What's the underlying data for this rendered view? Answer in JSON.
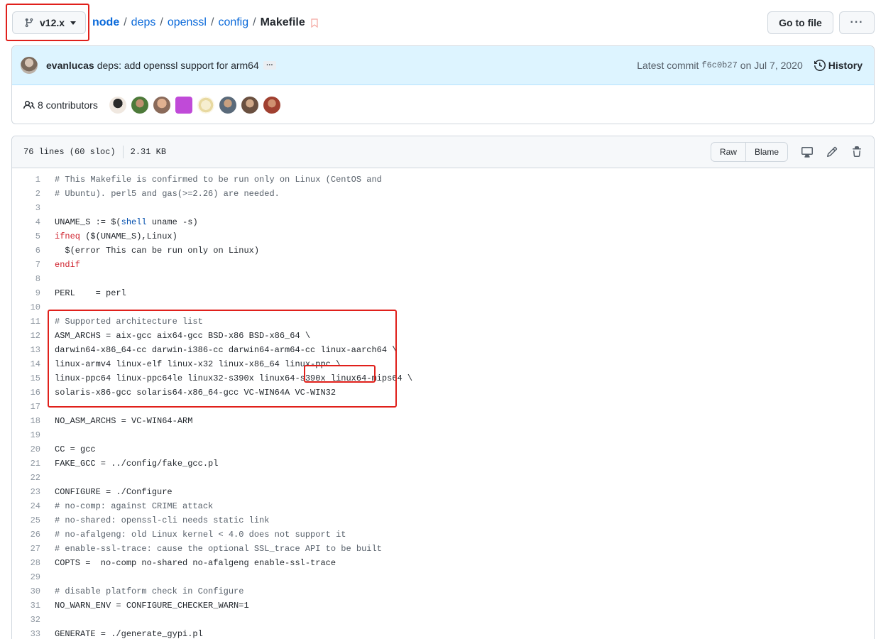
{
  "branch": {
    "name": "v12.x"
  },
  "breadcrumb": {
    "items": [
      "node",
      "deps",
      "openssl",
      "config"
    ],
    "current": "Makefile"
  },
  "header_actions": {
    "goto_file": "Go to file",
    "more": "···"
  },
  "commit": {
    "author": "evanlucas",
    "message": "deps: add openssl support for arm64",
    "ellipsis": "…",
    "latest_label": "Latest commit",
    "sha": "f6c0b27",
    "date": "on Jul 7, 2020",
    "history": "History"
  },
  "contributors": {
    "label": "8 contributors",
    "count": 8
  },
  "file": {
    "info_lines": "76 lines (60 sloc)",
    "info_size": "2.31 KB",
    "raw": "Raw",
    "blame": "Blame"
  },
  "code_lines": [
    {
      "n": "1",
      "parts": [
        {
          "t": "# This Makefile is confirmed to be run only on Linux (CentOS and",
          "k": "c"
        }
      ]
    },
    {
      "n": "2",
      "parts": [
        {
          "t": "# Ubuntu). perl5 and gas(>=2.26) are needed.",
          "k": "c"
        }
      ]
    },
    {
      "n": "3",
      "parts": [
        {
          "t": "",
          "k": ""
        }
      ]
    },
    {
      "n": "4",
      "parts": [
        {
          "t": "UNAME_S := $(",
          "k": ""
        },
        {
          "t": "shell",
          "k": "f"
        },
        {
          "t": " uname -s)",
          "k": ""
        }
      ]
    },
    {
      "n": "5",
      "parts": [
        {
          "t": "ifneq",
          "k": "k"
        },
        {
          "t": " ($(UNAME_S),Linux)",
          "k": ""
        }
      ]
    },
    {
      "n": "6",
      "parts": [
        {
          "t": "  $(error This can be run only on Linux)",
          "k": ""
        }
      ]
    },
    {
      "n": "7",
      "parts": [
        {
          "t": "endif",
          "k": "k"
        }
      ]
    },
    {
      "n": "8",
      "parts": [
        {
          "t": "",
          "k": ""
        }
      ]
    },
    {
      "n": "9",
      "parts": [
        {
          "t": "PERL    = perl",
          "k": ""
        }
      ]
    },
    {
      "n": "10",
      "parts": [
        {
          "t": "",
          "k": ""
        }
      ]
    },
    {
      "n": "11",
      "parts": [
        {
          "t": "# Supported architecture list",
          "k": "c"
        }
      ]
    },
    {
      "n": "12",
      "parts": [
        {
          "t": "ASM_ARCHS = aix-gcc aix64-gcc BSD-x86 BSD-x86_64 \\",
          "k": ""
        }
      ]
    },
    {
      "n": "13",
      "parts": [
        {
          "t": "darwin64-x86_64-cc darwin-i386-cc darwin64-arm64-cc linux-aarch64 \\",
          "k": ""
        }
      ]
    },
    {
      "n": "14",
      "parts": [
        {
          "t": "linux-armv4 linux-elf linux-x32 linux-x86_64 linux-ppc \\",
          "k": ""
        }
      ]
    },
    {
      "n": "15",
      "parts": [
        {
          "t": "linux-ppc64 linux-ppc64le linux32-s390x linux64-s390x linux64-mips64 \\",
          "k": ""
        }
      ]
    },
    {
      "n": "16",
      "parts": [
        {
          "t": "solaris-x86-gcc solaris64-x86_64-gcc VC-WIN64A VC-WIN32",
          "k": ""
        }
      ]
    },
    {
      "n": "17",
      "parts": [
        {
          "t": "",
          "k": ""
        }
      ]
    },
    {
      "n": "18",
      "parts": [
        {
          "t": "NO_ASM_ARCHS = VC-WIN64-ARM",
          "k": ""
        }
      ]
    },
    {
      "n": "19",
      "parts": [
        {
          "t": "",
          "k": ""
        }
      ]
    },
    {
      "n": "20",
      "parts": [
        {
          "t": "CC = gcc",
          "k": ""
        }
      ]
    },
    {
      "n": "21",
      "parts": [
        {
          "t": "FAKE_GCC = ../config/fake_gcc.pl",
          "k": ""
        }
      ]
    },
    {
      "n": "22",
      "parts": [
        {
          "t": "",
          "k": ""
        }
      ]
    },
    {
      "n": "23",
      "parts": [
        {
          "t": "CONFIGURE = ./Configure",
          "k": ""
        }
      ]
    },
    {
      "n": "24",
      "parts": [
        {
          "t": "# no-comp: against CRIME attack",
          "k": "c"
        }
      ]
    },
    {
      "n": "25",
      "parts": [
        {
          "t": "# no-shared: openssl-cli needs static link",
          "k": "c"
        }
      ]
    },
    {
      "n": "26",
      "parts": [
        {
          "t": "# no-afalgeng: old Linux kernel < 4.0 does not support it",
          "k": "c"
        }
      ]
    },
    {
      "n": "27",
      "parts": [
        {
          "t": "# enable-ssl-trace: cause the optional SSL_trace API to be built",
          "k": "c"
        }
      ]
    },
    {
      "n": "28",
      "parts": [
        {
          "t": "COPTS =  no-comp no-shared no-afalgeng enable-ssl-trace",
          "k": ""
        }
      ]
    },
    {
      "n": "29",
      "parts": [
        {
          "t": "",
          "k": ""
        }
      ]
    },
    {
      "n": "30",
      "parts": [
        {
          "t": "# disable platform check in Configure",
          "k": "c"
        }
      ]
    },
    {
      "n": "31",
      "parts": [
        {
          "t": "NO_WARN_ENV = CONFIGURE_CHECKER_WARN=1",
          "k": ""
        }
      ]
    },
    {
      "n": "32",
      "parts": [
        {
          "t": "",
          "k": ""
        }
      ]
    },
    {
      "n": "33",
      "parts": [
        {
          "t": "GENERATE = ./generate_gypi.pl",
          "k": ""
        }
      ]
    }
  ],
  "colors": {
    "link": "#0969da",
    "highlight_box": "#e0201b",
    "commit_bg": "#ddf4ff"
  },
  "contributor_avatar_colors": [
    "#6e5a4a",
    "#4d7a3a",
    "#b08060",
    "#c04ad8",
    "#e8d9a0",
    "#5a6a7a",
    "#8a6a5a",
    "#a04030"
  ]
}
